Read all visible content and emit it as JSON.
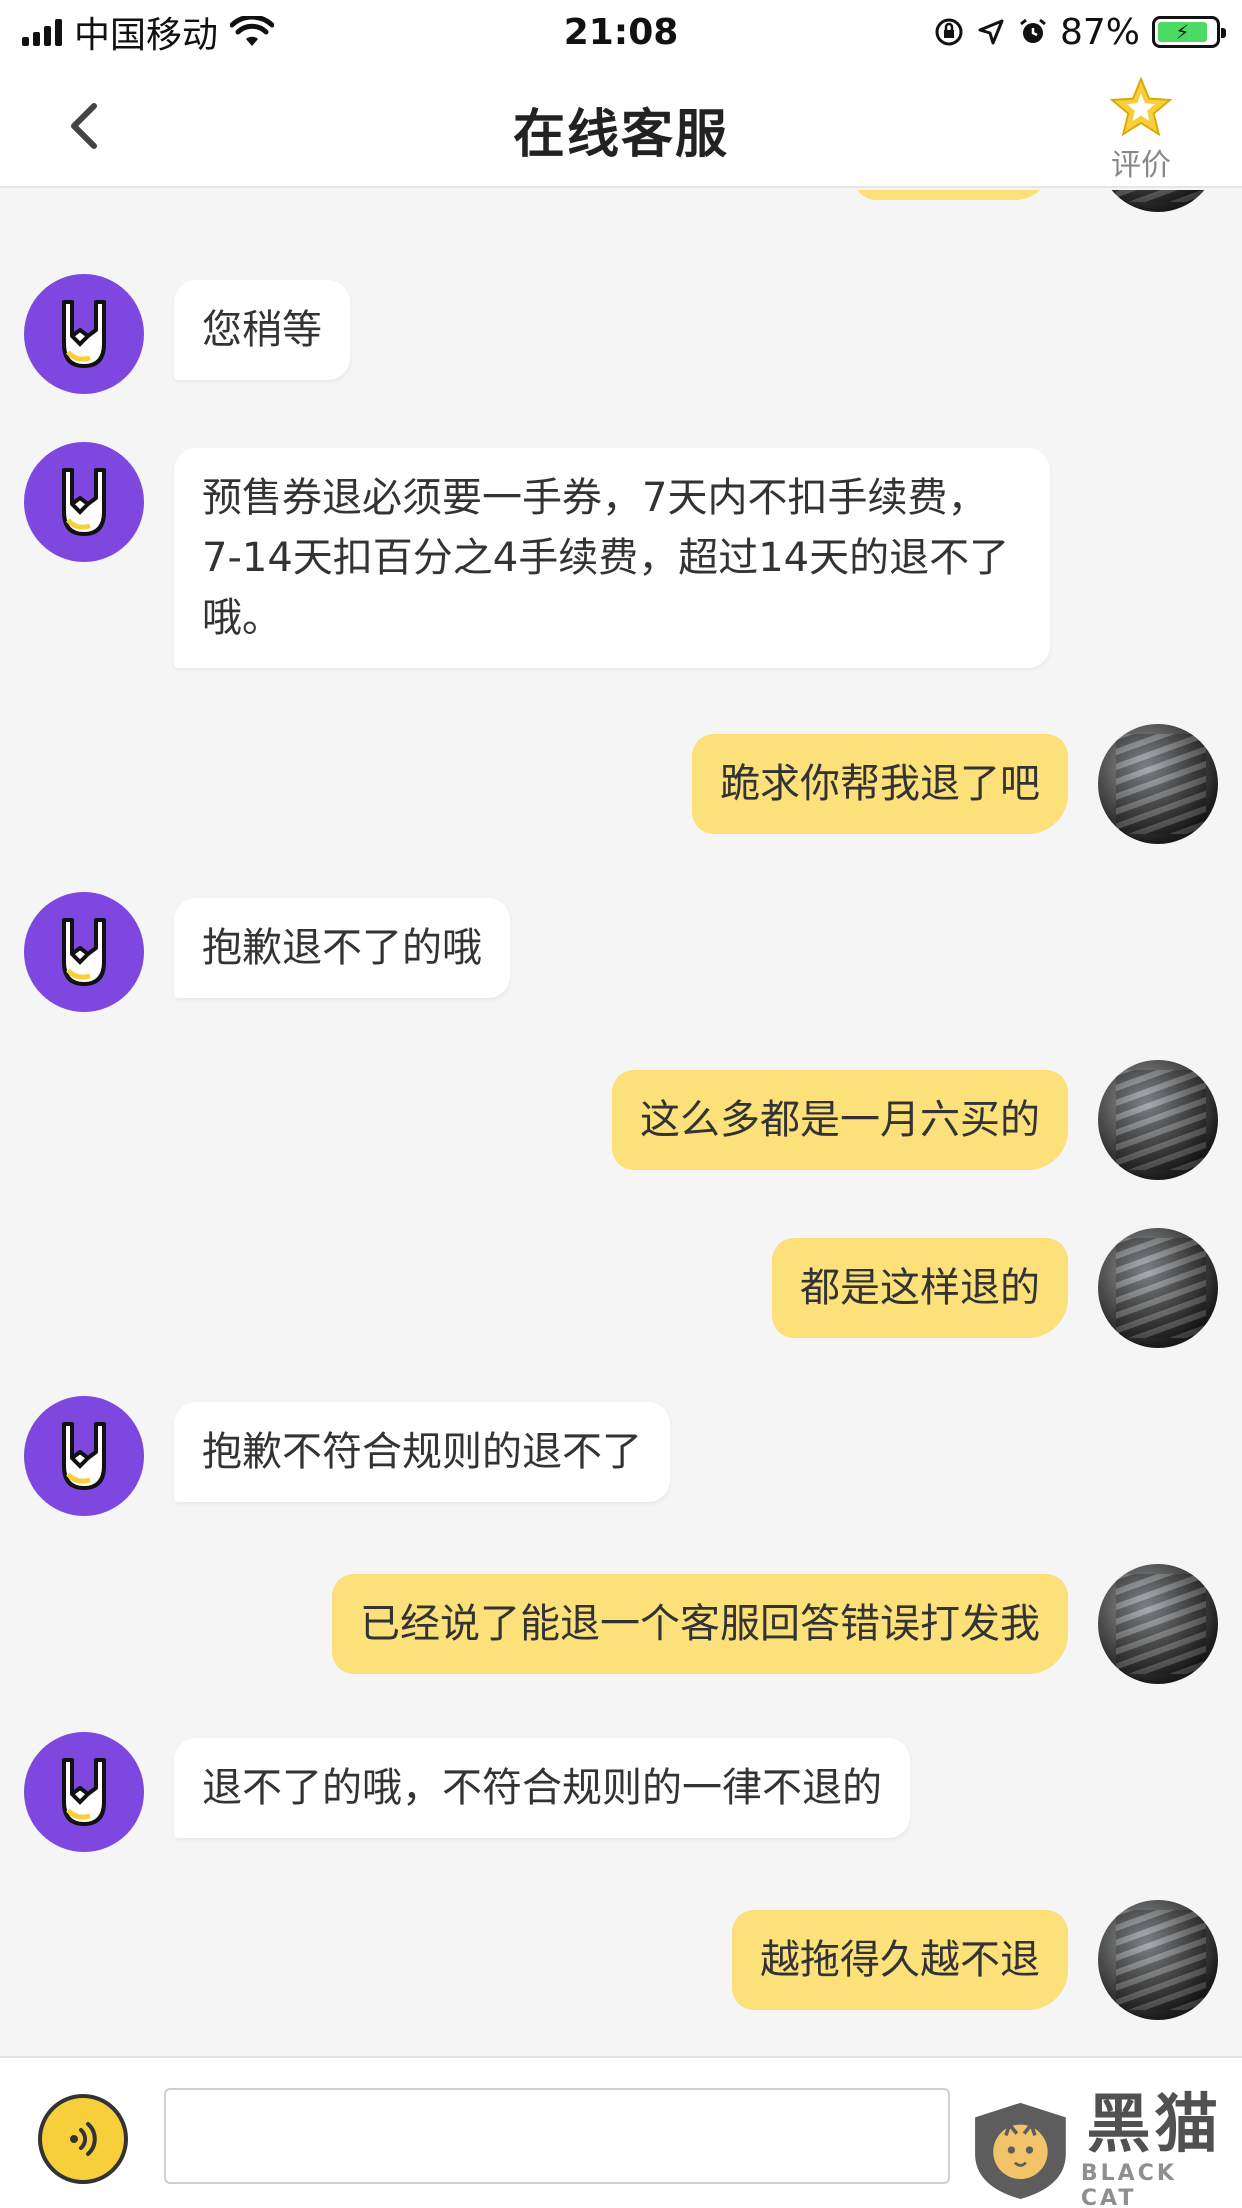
{
  "status_bar": {
    "carrier": "中国移动",
    "time": "21:08",
    "battery_percent": "87%",
    "icons": [
      "signal-icon",
      "wifi-icon",
      "orientation-lock-icon",
      "location-icon",
      "alarm-icon",
      "battery-charging-icon"
    ]
  },
  "nav": {
    "title": "在线客服",
    "back_icon": "chevron-left-icon",
    "rate_label": "评价",
    "rate_icon": "star-icon"
  },
  "messages": [
    {
      "from": "agent",
      "text": "您稍等"
    },
    {
      "from": "agent",
      "text": "预售券退必须要一手券，7天内不扣手续费，7-14天扣百分之4手续费，超过14天的退不了哦。"
    },
    {
      "from": "user",
      "text": "跪求你帮我退了吧"
    },
    {
      "from": "agent",
      "text": "抱歉退不了的哦"
    },
    {
      "from": "user",
      "text": "这么多都是一月六买的"
    },
    {
      "from": "user",
      "text": "都是这样退的"
    },
    {
      "from": "agent",
      "text": "抱歉不符合规则的退不了"
    },
    {
      "from": "user",
      "text": "已经说了能退一个客服回答错误打发我"
    },
    {
      "from": "agent",
      "text": "退不了的哦，不符合规则的一律不退的"
    },
    {
      "from": "user",
      "text": "越拖得久越不退"
    }
  ],
  "input_bar": {
    "voice_icon": "voice-icon",
    "input_value": "",
    "input_placeholder": ""
  },
  "watermark": {
    "text_cn": "黑猫",
    "text_en": "BLACK CAT"
  },
  "colors": {
    "accent_yellow": "#fce07a",
    "agent_purple": "#7e47e0",
    "background": "#f5f5f5",
    "star": "#f7cf3b"
  }
}
